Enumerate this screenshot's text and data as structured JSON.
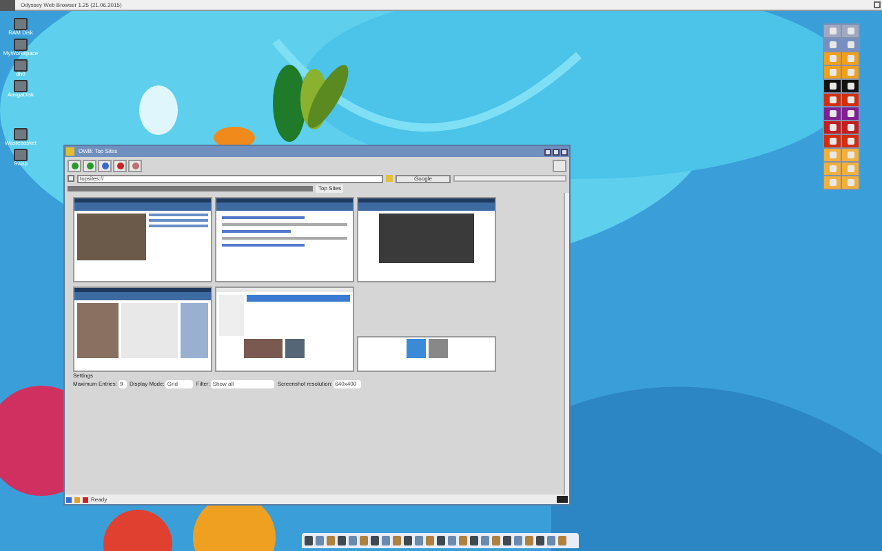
{
  "top_bar": {
    "title": "Odyssey Web Browser 1.25 (21.06.2015)"
  },
  "desktop_icons": [
    {
      "label": "RAM Disk"
    },
    {
      "label": "MyWorkspace"
    },
    {
      "label": "dh0"
    },
    {
      "label": "AmigaDisk"
    },
    {
      "label": "Wastebasket"
    },
    {
      "label": "Swap"
    }
  ],
  "window": {
    "title": "OWB: Top Sites",
    "address": "topsites://",
    "search": "Google",
    "tabs": [
      {
        "label": "Top Sites",
        "selected": true
      }
    ],
    "thumbnails": [
      {
        "kind": "article"
      },
      {
        "kind": "text"
      },
      {
        "kind": "dark"
      },
      {
        "kind": "news"
      },
      {
        "kind": "video"
      },
      {
        "kind": "small"
      }
    ],
    "settings": {
      "heading": "Settings",
      "fields": [
        {
          "label": "Maximum Entries:",
          "value": "9"
        },
        {
          "label": "Display Mode:",
          "value": "Grid"
        },
        {
          "label": "Filter:",
          "value": "Show all"
        },
        {
          "label": "Screenshot resolution:",
          "value": "640x400"
        }
      ]
    },
    "status": "Ready"
  }
}
